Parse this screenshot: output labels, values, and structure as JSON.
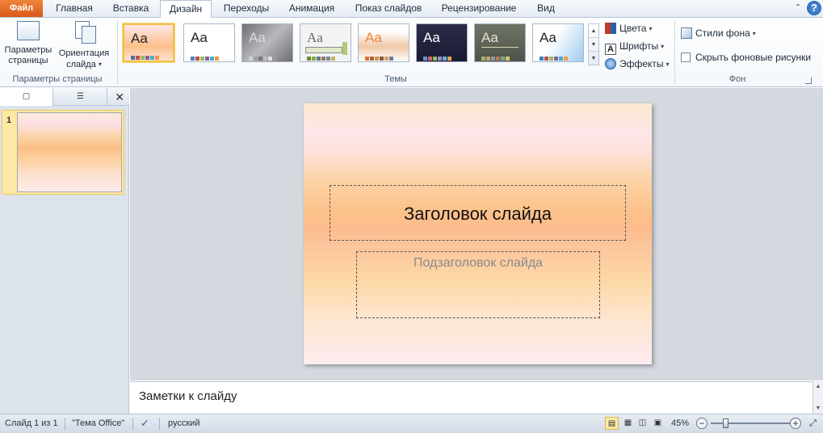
{
  "tabs": {
    "file": "Файл",
    "items": [
      "Главная",
      "Вставка",
      "Дизайн",
      "Переходы",
      "Анимация",
      "Показ слайдов",
      "Рецензирование",
      "Вид"
    ],
    "active_index": 2,
    "help": "?"
  },
  "ribbon": {
    "page_setup_btn": "Параметры страницы",
    "orientation_btn": "Ориентация слайда",
    "page_setup_group": "Параметры страницы",
    "themes_group": "Темы",
    "theme_glyph": "Aa",
    "colors_btn": "Цвета",
    "fonts_btn": "Шрифты",
    "effects_btn": "Эффекты",
    "bg_styles_btn": "Стили фона",
    "hide_bg_label": "Скрыть фоновые рисунки",
    "bg_group": "Фон"
  },
  "left_pane": {
    "slide_number": "1"
  },
  "slide": {
    "title_placeholder": "Заголовок слайда",
    "subtitle_placeholder": "Подзаголовок слайда"
  },
  "notes": {
    "placeholder": "Заметки к слайду"
  },
  "status": {
    "slide_info": "Слайд 1 из 1",
    "theme": "\"Тема Office\"",
    "language": "русский",
    "zoom": "45%"
  },
  "colors": {
    "file_tab": "#e06a2a",
    "selected_theme_border": "#f0c042",
    "selection_highlight": "#fde8a6"
  }
}
